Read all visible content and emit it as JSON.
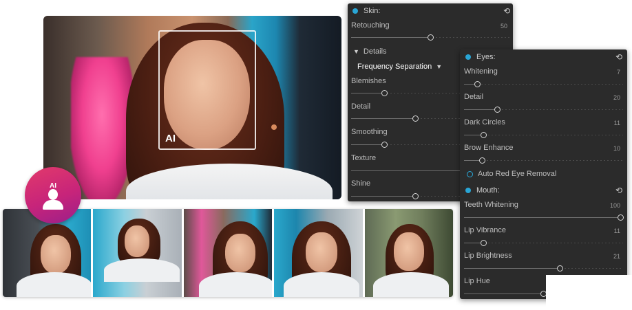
{
  "hero": {
    "ai_label": "AI"
  },
  "badge": {
    "text": "AI"
  },
  "thumbnails": [
    {
      "id": 1
    },
    {
      "id": 2
    },
    {
      "id": 3
    },
    {
      "id": 4
    },
    {
      "id": 5
    }
  ],
  "skin_panel": {
    "title": "Skin:",
    "retouching": {
      "label": "Retouching",
      "value": "50",
      "level": 0.5
    },
    "details_label": "Details",
    "frequency_separation": "Frequency Separation",
    "blemishes": {
      "label": "Blemishes",
      "level": 0.21
    },
    "detail": {
      "label": "Detail",
      "level": 0.41
    },
    "smoothing": {
      "label": "Smoothing",
      "level": 0.21
    },
    "texture": {
      "label": "Texture"
    },
    "shine": {
      "label": "Shine",
      "level": 0.41
    }
  },
  "eyes_panel": {
    "title": "Eyes:",
    "whitening": {
      "label": "Whitening",
      "value": "7",
      "level": 0.07
    },
    "detail": {
      "label": "Detail",
      "value": "20",
      "level": 0.2
    },
    "dark_circles": {
      "label": "Dark Circles",
      "value": "11",
      "level": 0.11
    },
    "brow_enhance": {
      "label": "Brow Enhance",
      "value": "10",
      "level": 0.1
    },
    "auto_red_eye": "Auto Red Eye Removal",
    "mouth_title": "Mouth:",
    "teeth_whitening": {
      "label": "Teeth Whitening",
      "value": "100",
      "level": 1.0
    },
    "lip_vibrance": {
      "label": "Lip Vibrance",
      "value": "11",
      "level": 0.11
    },
    "lip_brightness": {
      "label": "Lip Brightness",
      "value": "21",
      "level": 0.6
    },
    "lip_hue": {
      "label": "Lip Hue",
      "level": 0.52
    }
  },
  "colors": {
    "accent": "#29a6d6",
    "panel_bg": "#2b2b2b",
    "badge_start": "#e23a6b",
    "badge_end": "#9a1f8a"
  }
}
